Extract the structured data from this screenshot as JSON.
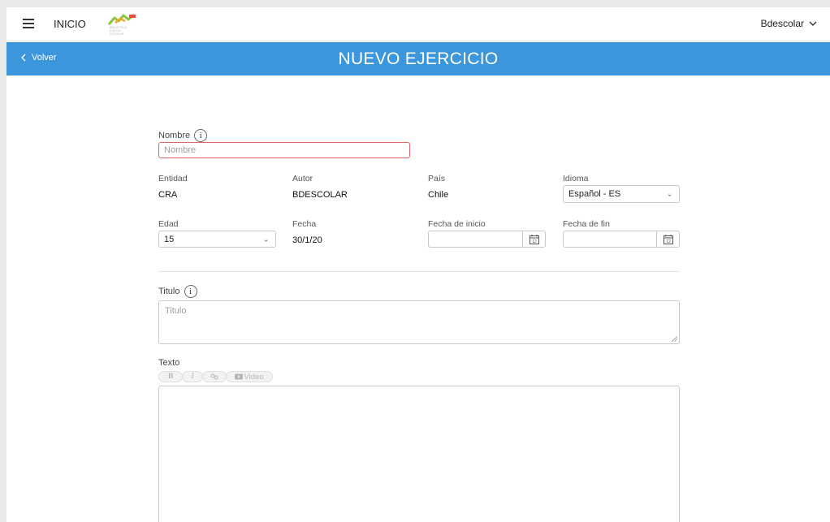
{
  "header": {
    "menu_icon": "hamburger-menu-icon",
    "home_label": "INICIO",
    "logo_text": "BIBLIOTECA DIGITAL ESCOLAR",
    "user_label": "Bdescolar",
    "user_icon": "chevron-down-icon"
  },
  "title_bar": {
    "back_label": "Volver",
    "title": "NUEVO EJERCICIO",
    "color": "#3b96dc"
  },
  "form": {
    "nombre": {
      "label": "Nombre",
      "placeholder": "Nombre",
      "error_color": "#e06767"
    },
    "entidad": {
      "label": "Entidad",
      "value": "CRA"
    },
    "autor": {
      "label": "Autor",
      "value": "BDESCOLAR"
    },
    "pais": {
      "label": "País",
      "value": "Chile"
    },
    "idioma": {
      "label": "Idioma",
      "value": "Español - ES"
    },
    "edad": {
      "label": "Edad",
      "value": "15"
    },
    "fecha": {
      "label": "Fecha",
      "value": "30/1/20"
    },
    "fecha_inicio": {
      "label": "Fecha de inicio",
      "value": ""
    },
    "fecha_fin": {
      "label": "Fecha de fin",
      "value": ""
    },
    "calendar_day": "12",
    "titulo": {
      "label": "Titulo",
      "placeholder": "Titulo"
    },
    "texto": {
      "label": "Texto",
      "toolbar": {
        "bold": "B",
        "italic": "I",
        "link_icon": "link-icon",
        "video_icon": "video-icon",
        "video": "Video"
      }
    }
  }
}
